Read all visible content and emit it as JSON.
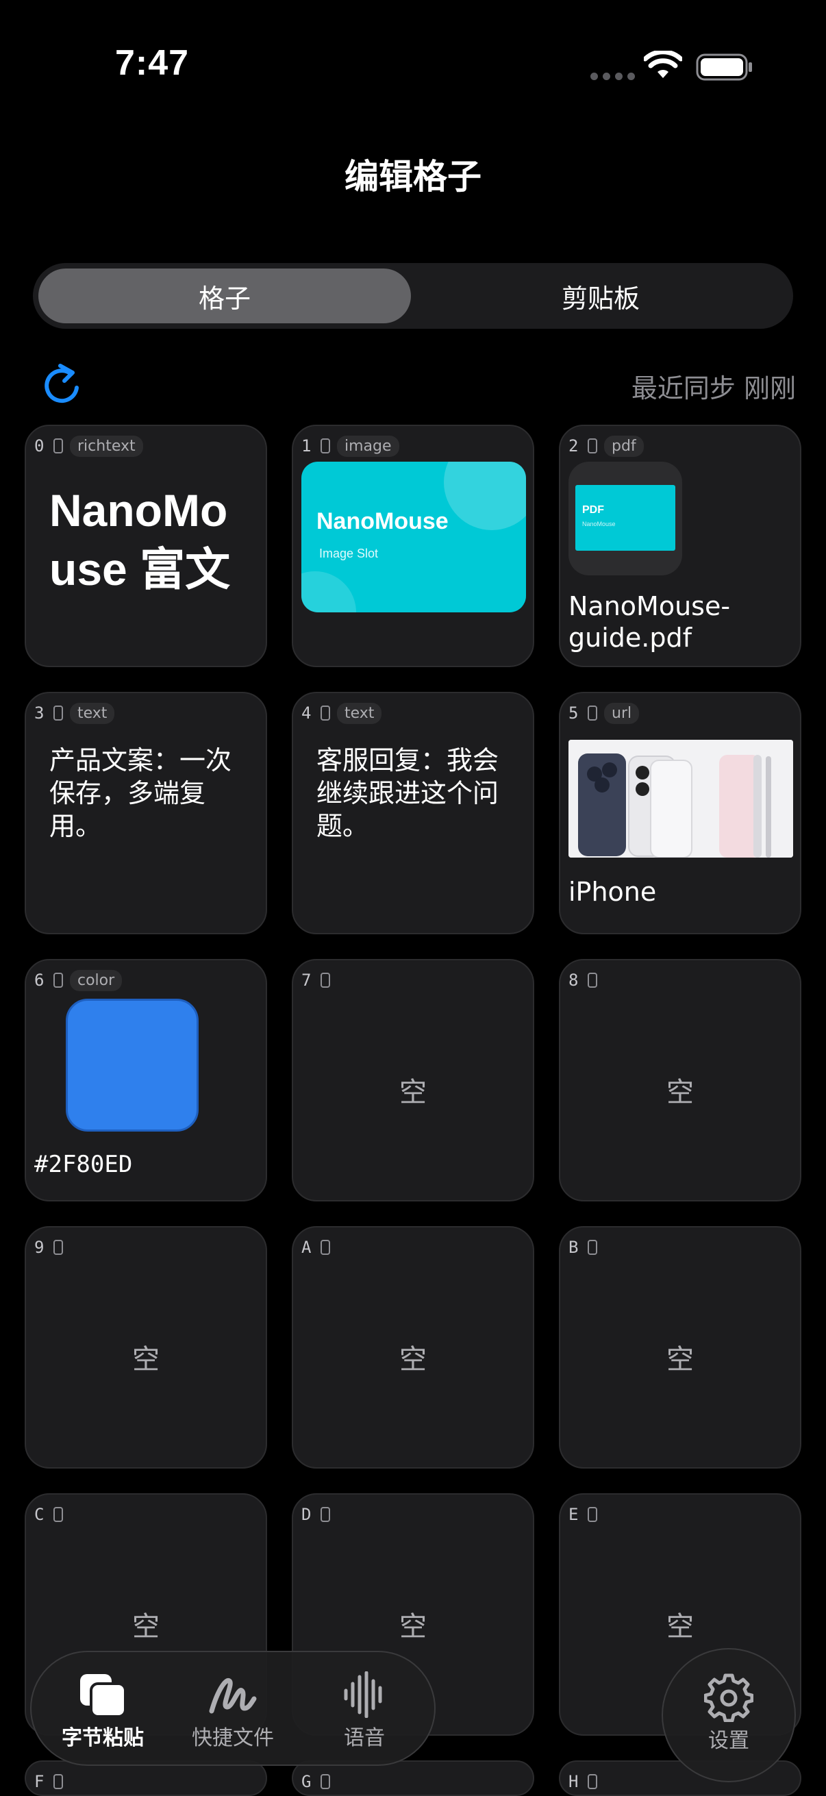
{
  "status_bar": {
    "time": "7:47"
  },
  "page_title": "编辑格子",
  "segments": {
    "active": "格子",
    "inactive": "剪贴板"
  },
  "sync_status": "最近同步 刚刚",
  "empty_label": "空",
  "cells": [
    {
      "index": "0",
      "tag": "richtext",
      "content": "NanoMouse 富文"
    },
    {
      "index": "1",
      "tag": "image",
      "title": "NanoMouse",
      "subtitle": "Image Slot"
    },
    {
      "index": "2",
      "tag": "pdf",
      "thumb_title": "PDF",
      "thumb_sub": "NanoMouse",
      "filename": "NanoMouse-guide.pdf"
    },
    {
      "index": "3",
      "tag": "text",
      "content": "产品文案：一次保存，多端复用。"
    },
    {
      "index": "4",
      "tag": "text",
      "content": "客服回复：我会继续跟进这个问题。"
    },
    {
      "index": "5",
      "tag": "url",
      "title": "iPhone"
    },
    {
      "index": "6",
      "tag": "color",
      "hex": "#2F80ED"
    },
    {
      "index": "7"
    },
    {
      "index": "8"
    },
    {
      "index": "9"
    },
    {
      "index": "A"
    },
    {
      "index": "B"
    },
    {
      "index": "C"
    },
    {
      "index": "D"
    },
    {
      "index": "E"
    },
    {
      "index": "F"
    },
    {
      "index": "G"
    },
    {
      "index": "H"
    }
  ],
  "tabbar": {
    "items": [
      {
        "label": "字节粘贴",
        "icon": "copy-icon",
        "active": true
      },
      {
        "label": "快捷文件",
        "icon": "scribble-icon",
        "active": false
      },
      {
        "label": "语音",
        "icon": "waveform-icon",
        "active": false
      }
    ],
    "settings_label": "设置"
  },
  "colors": {
    "accent": "#2F80ED",
    "image_bg": "#00C9D6",
    "cell_bg": "#1C1C1E",
    "segment_active": "#636366"
  }
}
